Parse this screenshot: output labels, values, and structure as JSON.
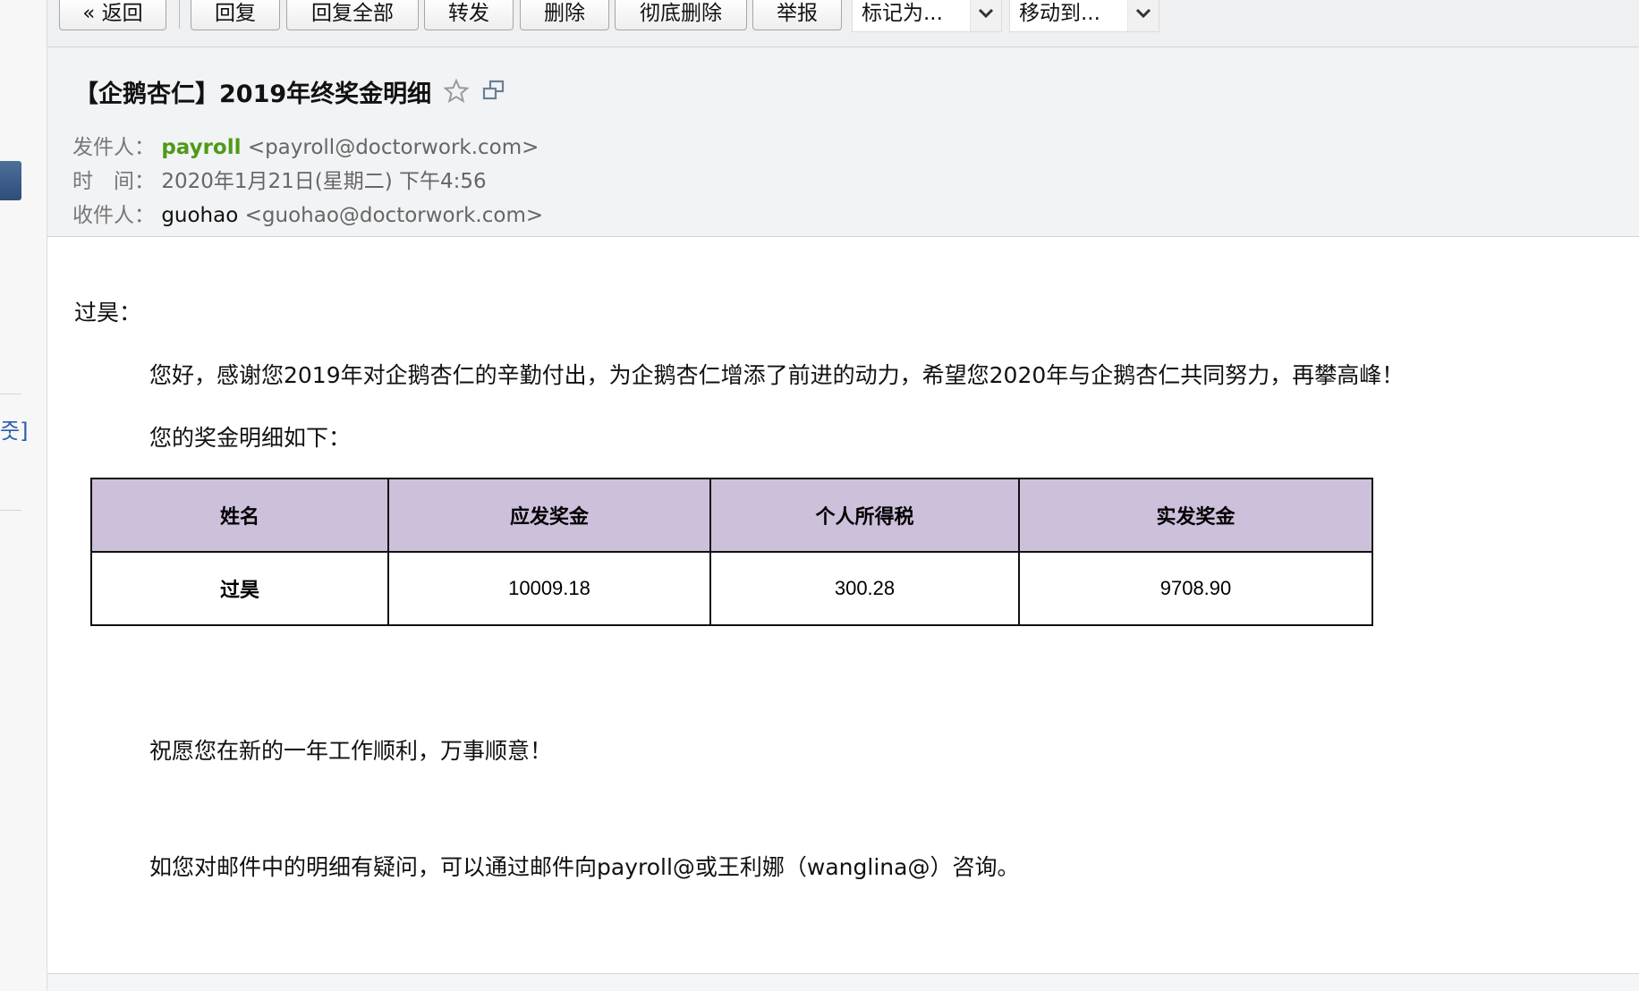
{
  "left_pane": {
    "link_fragment": "줏]"
  },
  "toolbar": {
    "back": "« 返回",
    "reply": "回复",
    "reply_all": "回复全部",
    "forward": "转发",
    "delete": "删除",
    "delete_permanently": "彻底删除",
    "report": "举报",
    "mark_as": "标记为...",
    "move_to": "移动到..."
  },
  "header": {
    "subject": "【企鹅杏仁】2019年终奖金明细",
    "from_label": "发件人：",
    "from_name": "payroll",
    "from_addr": "<payroll@doctorwork.com>",
    "time_label": "时　间：",
    "time_value": "2020年1月21日(星期二) 下午4:56",
    "to_label": "收件人：",
    "to_name": "guohao",
    "to_addr": "<guohao@doctorwork.com>"
  },
  "body": {
    "greeting": "过昊：",
    "para1": "您好，感谢您2019年对企鹅杏仁的辛勤付出，为企鹅杏仁增添了前进的动力，希望您2020年与企鹅杏仁共同努力，再攀高峰！",
    "para2": "您的奖金明细如下：",
    "table": {
      "headers": [
        "姓名",
        "应发奖金",
        "个人所得税",
        "实发奖金"
      ],
      "row": [
        "过昊",
        "10009.18",
        "300.28",
        "9708.90"
      ]
    },
    "wish": "祝愿您在新的一年工作顺利，万事顺意！",
    "contact": "如您对邮件中的明细有疑问，可以通过邮件向payroll@或王利娜（wanglina@）咨询。"
  },
  "colors": {
    "sender_name": "#4e9a18",
    "table_header_bg": "#cdc0da",
    "header_bg": "#f2f3f5"
  }
}
